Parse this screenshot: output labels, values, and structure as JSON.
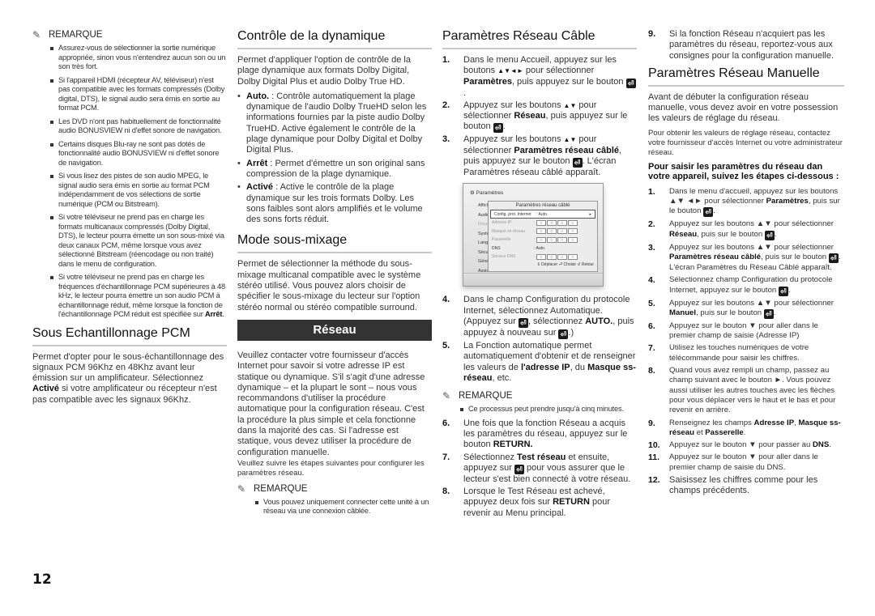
{
  "page_number": "12",
  "col1": {
    "remark_label": "REMARQUE",
    "remark_items": [
      "Assurez-vous de sélectionner la sortie numérique appropriée, sinon vous n'entendrez aucun son ou un son très fort.",
      "Si l'appareil HDMI (récepteur AV, téléviseur) n'est pas compatible avec les formats compressés (Dolby digital, DTS), le signal audio sera émis en sortie au format PCM.",
      "Les DVD n'ont pas habituellement de fonctionnalité audio BONUSVIEW ni d'effet sonore de navigation.",
      "Certains disques Blu-ray ne sont pas dotés de fonctionnalité audio BONUSVIEW ni d'effet sonore de navigation.",
      "Si vous lisez des pistes de son audio MPEG, le signal audio sera émis en sortie au format PCM indépendamment de vos sélections de sortie numérique (PCM ou Bitstream).",
      "Si votre téléviseur ne prend pas en charge les formats multicanaux compressés (Dolby Digital, DTS), le lecteur pourra émette un son sous-mixé via deux canaux PCM, même lorsque vous avez sélectionné Bitstream (réencodage ou non traité) dans le menu de configuration."
    ],
    "remark_last_prefix": "Si votre téléviseur ne prend pas en charge les fréquences d'échantillonnage PCM supérieures à 48 kHz, le lecteur pourra émettre un son audio PCM à échantillonnage réduit, même lorsque la fonction de l'échantillonnage PCM réduit est spécifiée sur ",
    "remark_last_bold": "Arrêt",
    "remark_last_suffix": ".",
    "pcm_title": "Sous Echantillonnage PCM",
    "pcm_text_1": "Permet d'opter pour le sous-échantillonnage des signaux PCM 96Khz en 48Khz avant leur émission sur un amplificateur.  Sélectionnez ",
    "pcm_bold": "Activé",
    "pcm_text_2": " si votre amplificateur ou récepteur n'est pas compatible avec les signaux 96Khz."
  },
  "col2": {
    "drc_title": "Contrôle de la dynamique",
    "drc_intro": "Permet d'appliquer l'option de contrôle de la plage dynamique aux formats Dolby Digital, Dolby Digital Plus et audio Dolby True HD.",
    "drc_options": [
      {
        "label": "Auto.",
        "text": " : Contrôle automatiquement la plage dynamique de l'audio Dolby TrueHD selon les informations fournies par la piste audio Dolby TrueHD. Active également le contrôle de la plage dynamique pour Dolby Digital et Dolby Digital Plus."
      },
      {
        "label": "Arrêt",
        "text": " : Permet d'émettre un son original sans compression de la plage dynamique."
      },
      {
        "label": "Activé",
        "text": " : Active le contrôle de la plage dynamique sur les trois formats Dolby. Les sons faibles sont alors amplifiés et le volume des sons forts réduit."
      }
    ],
    "downmix_title": "Mode sous-mixage",
    "downmix_text": "Permet de sélectionner la méthode du sous-mixage multicanal compatible avec le système stéréo utilisé. Vous pouvez alors choisir de spécifier le sous-mixage du lecteur sur l'option stéréo normal ou stéréo compatible surround.",
    "network_banner": "Réseau",
    "network_text_1": "Veuillez contacter votre fournisseur d'accès Internet pour savoir si votre adresse IP est statique ou dynamique. S'il s'agit d'une adresse dynamique – et la plupart le sont – nous vous recommandons d'utiliser la procédure automatique pour la configuration réseau. C'est la procédure la plus simple et cela fonctionne dans la majorité des cas. Si l'adresse est statique, vous devez utiliser la procédure de configuration manuelle.",
    "network_text_2": "Veuillez suivre les étapes suivantes pour configurer les paramètres réseau.",
    "remark_label": "REMARQUE",
    "remark_items": [
      "Vous pouvez uniquement connecter cette unité à un réseau via une connexion câblée."
    ]
  },
  "col3": {
    "title": "Paramètres Réseau Câble",
    "steps": [
      {
        "num": "1.",
        "html_parts": [
          "Dans le menu Accueil, appuyez sur les boutons ",
          "▲▼◄►",
          " pour sélectionner ",
          "Paramètres",
          ", puis appuyez sur le bouton ",
          "ENTER",
          "."
        ]
      },
      {
        "num": "2.",
        "html_parts": [
          "Appuyez sur les boutons ",
          "▲▼",
          " pour sélectionner ",
          "Réseau",
          ", puis appuyez sur le bouton ",
          "ENTER",
          "."
        ]
      },
      {
        "num": "3.",
        "html_parts": [
          "Appuyez sur les boutons ",
          "▲▼",
          " pour sélectionner ",
          "Paramètres réseau câblé",
          ", puis appuyez sur le bouton ",
          "ENTER",
          ". L'écran Paramètres réseau câblé apparaît."
        ]
      }
    ],
    "screen": {
      "header": "Paramètres",
      "menu_items": [
        "Affich",
        "Audio",
        "Réseau",
        "Systè",
        "Langu",
        "Sécur",
        "Génér",
        "Assis"
      ],
      "popup_title": "Paramètres réseau câblé",
      "rows": [
        {
          "label": "Config. prot. Internet",
          "value": ": Auto.",
          "selected": true
        },
        {
          "label": "Adresse IP",
          "boxes": [
            "0",
            "0",
            "0",
            "0"
          ]
        },
        {
          "label": "Masque ss-réseau",
          "boxes": [
            "0",
            "0",
            "0",
            "0"
          ]
        },
        {
          "label": "Passerelle",
          "boxes": [
            "0",
            "0",
            "0",
            "0"
          ]
        },
        {
          "label": "DNS",
          "value": ": Auto."
        },
        {
          "label": "Serveur DNS",
          "boxes": [
            "0",
            "0",
            "0",
            "0"
          ]
        }
      ],
      "footer": "⇕ Déplacer  ⮐ Choisir  ↺ Retour"
    },
    "steps_b": [
      {
        "num": "4.",
        "t1": "Dans le champ Configuration du protocole Internet, sélectionnez Automatique. (Appuyez sur ",
        "t2": ", sélectionnez ",
        "b1": "AUTO.",
        "t3": ", puis appuyez à nouveau sur ",
        "t4": ".)"
      },
      {
        "num": "5.",
        "t1": "La Fonction automatique permet automatiquement d'obtenir et de renseigner les valeurs de ",
        "b1": "l'adresse IP",
        "t2": ", du ",
        "b2": "Masque ss-réseau",
        "t3": ", etc."
      }
    ],
    "remark_label": "REMARQUE",
    "remark_items": [
      "Ce processus peut prendre jusqu'à cinq minutes."
    ],
    "steps_c": [
      {
        "num": "6.",
        "t1": "Une fois que la fonction Réseau a acquis les paramètres du réseau, appuyez sur le bouton ",
        "b1": "RETURN.",
        "t2": ""
      },
      {
        "num": "7.",
        "t1": "Sélectionnez ",
        "b1": "Test réseau",
        "t2": " et ensuite, appuyez sur ",
        "t3": " pour vous assurer que le lecteur s'est bien connecté à votre réseau."
      },
      {
        "num": "8.",
        "t1": "Lorsque le Test Réseau est achevé, appuyez deux fois sur ",
        "b1": "RETURN",
        "t2": " pour revenir au Menu principal."
      }
    ]
  },
  "col4": {
    "step9_num": "9.",
    "step9_text": "Si la fonction Réseau n'acquiert pas les paramètres du réseau, reportez-vous aux consignes pour la configuration manuelle.",
    "title": "Paramètres Réseau Manuelle",
    "intro": "Avant de débuter la configuration réseau manuelle, vous devez avoir en votre possession les valeurs de réglage du réseau.",
    "intro_small": "Pour obtenir les valeurs de réglage réseau, contactez votre fournisseur d'accès Internet ou votre administrateur réseau.",
    "subheading": "Pour saisir les paramètres du réseau dan votre appareil, suivez les étapes ci-dessous :",
    "steps": [
      {
        "num": "1.",
        "t1": "Dans le menu d'accueil, appuyez sur les boutons ▲▼ ◄► pour sélectionner ",
        "b1": "Paramètres",
        "t2": ", puis sur le bouton ",
        "enter": true,
        "t3": "."
      },
      {
        "num": "2.",
        "t1": "Appuyez sur les boutons ▲▼ pour sélectionner ",
        "b1": "Réseau",
        "t2": ", puis sur le bouton ",
        "enter": true,
        "t3": "."
      },
      {
        "num": "3.",
        "t1": "Appuyez sur les boutons ▲▼ pour sélectionner ",
        "b1": "Paramètres réseau câblé",
        "t2": ", puis sur le bouton ",
        "enter": true,
        "t3": ". L'écran Paramètres du Réseau Câblé apparaît."
      },
      {
        "num": "4.",
        "t1": "Sélectionnez champ Configuration du protocole Internet, appuyez sur le bouton ",
        "b1": "",
        "t2": "",
        "enter": true,
        "t3": "."
      },
      {
        "num": "5.",
        "t1": "Appuyez sur les boutons ▲▼ pour sélectionner ",
        "b1": "Manuel",
        "t2": ", puis sur le bouton ",
        "enter": true,
        "t3": "."
      },
      {
        "num": "6.",
        "t1": "Appuyez sur le bouton ▼ pour aller dans le premier champ de saisie (Adresse IP)",
        "b1": "",
        "t2": "",
        "t3": ""
      },
      {
        "num": "7.",
        "t1": "Utilisez les touches numériques de votre télécommande pour saisir les chiffres.",
        "b1": "",
        "t2": "",
        "t3": ""
      },
      {
        "num": "8.",
        "t1": "Quand vous avez rempli un champ, passez au champ suivant avec le bouton ►. Vous pouvez aussi utiliser les autres touches avec les flèches pour vous déplacer vers le haut et le bas et pour revenir en arrière.",
        "b1": "",
        "t2": "",
        "t3": ""
      },
      {
        "num": "9.",
        "t1": "Renseignez les champs ",
        "b1": "Adresse IP",
        "t2": ", ",
        "b2": "Masque ss-réseau",
        "t3": " et ",
        "b3": "Passerelle",
        "t4": "."
      },
      {
        "num": "10.",
        "t1": "Appuyez sur le bouton ▼ pour passer au ",
        "b1": "DNS",
        "t2": ".",
        "t3": ""
      },
      {
        "num": "11.",
        "t1": "Appuyez sur le bouton ▼ pour aller dans le premier champ de saisie du DNS.",
        "b1": "",
        "t2": "",
        "t3": ""
      },
      {
        "num": "12.",
        "t1": "Saisissez les chiffres comme pour les champs précédents.",
        "b1": "",
        "t2": "",
        "t3": "",
        "big": true
      }
    ]
  }
}
